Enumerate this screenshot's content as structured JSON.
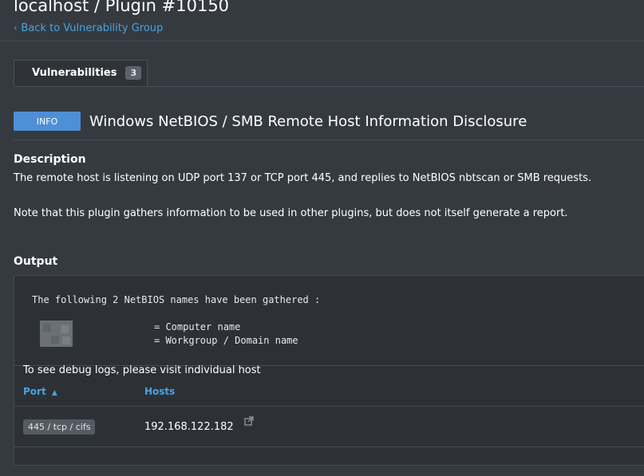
{
  "header": {
    "title": "localhost / Plugin #10150",
    "back_link": "Back to Vulnerability Group"
  },
  "tabs": [
    {
      "label": "Vulnerabilities",
      "count": "3"
    }
  ],
  "plugin": {
    "severity": "INFO",
    "name": "Windows NetBIOS / SMB Remote Host Information Disclosure"
  },
  "description": {
    "heading": "Description",
    "para1": "The remote host is listening on UDP port 137 or TCP port 445, and replies to NetBIOS nbtscan or SMB requests.",
    "para2": "Note that this plugin gathers information to be used in other plugins, but does not itself generate a report."
  },
  "output": {
    "heading": "Output",
    "line1": "The following 2 NetBIOS names have been gathered :",
    "line2": "= Computer name",
    "line3": "= Workgroup / Domain name",
    "debug_note": "To see debug logs, please visit individual host",
    "columns": {
      "port": "Port",
      "sort_indicator": "▲",
      "hosts": "Hosts"
    },
    "rows": [
      {
        "port": "445 / tcp / cifs",
        "host": "192.168.122.182"
      }
    ]
  },
  "icons": {
    "back": "chevron-left-icon",
    "external": "external-link-icon"
  },
  "colors": {
    "background": "#353a40",
    "link": "#4aa3df",
    "info_badge": "#4f8fd6"
  }
}
